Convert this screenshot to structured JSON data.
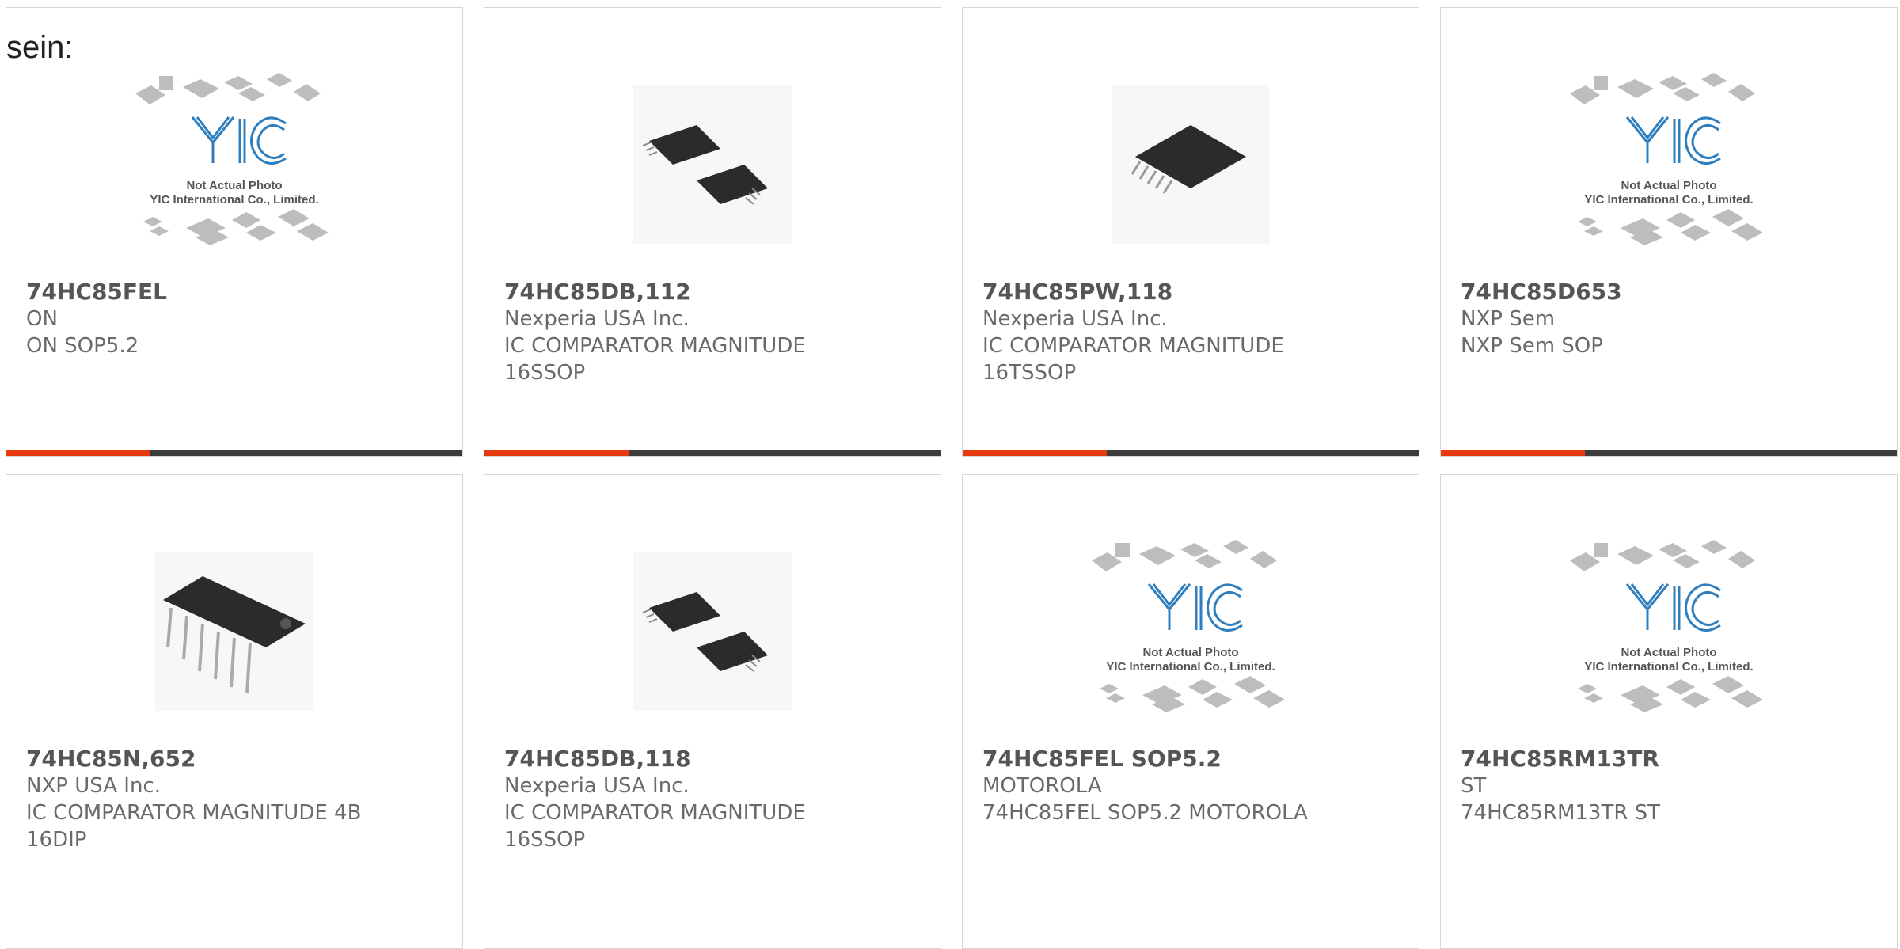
{
  "intro_text": "sein:",
  "placeholder": {
    "line1": "Not Actual Photo",
    "line2": "YIC International Co., Limited."
  },
  "colors": {
    "accent": "#e8380d",
    "bar": "#3c3c3c",
    "border": "#d6d6d6"
  },
  "products": [
    {
      "part": "74HC85FEL",
      "maker": "ON",
      "desc1": "ON SOP5.2",
      "desc2": "",
      "image": "placeholder",
      "bar": true
    },
    {
      "part": "74HC85DB,112",
      "maker": "Nexperia USA Inc.",
      "desc1": "IC COMPARATOR MAGNITUDE",
      "desc2": "16SSOP",
      "image": "ssop-pair",
      "bar": true
    },
    {
      "part": "74HC85PW,118",
      "maker": "Nexperia USA Inc.",
      "desc1": "IC COMPARATOR MAGNITUDE",
      "desc2": "16TSSOP",
      "image": "tssop",
      "bar": true
    },
    {
      "part": "74HC85D653",
      "maker": "NXP Sem",
      "desc1": "NXP Sem SOP",
      "desc2": "",
      "image": "placeholder",
      "bar": true
    },
    {
      "part": "74HC85N,652",
      "maker": "NXP USA Inc.",
      "desc1": "IC COMPARATOR MAGNITUDE 4B",
      "desc2": "16DIP",
      "image": "dip",
      "bar": false
    },
    {
      "part": "74HC85DB,118",
      "maker": "Nexperia USA Inc.",
      "desc1": "IC COMPARATOR MAGNITUDE",
      "desc2": "16SSOP",
      "image": "ssop-pair",
      "bar": false
    },
    {
      "part": "74HC85FEL SOP5.2",
      "maker": "MOTOROLA",
      "desc1": "74HC85FEL SOP5.2 MOTOROLA",
      "desc2": "",
      "image": "placeholder",
      "bar": false
    },
    {
      "part": "74HC85RM13TR",
      "maker": "ST",
      "desc1": "74HC85RM13TR ST",
      "desc2": "",
      "image": "placeholder",
      "bar": false
    }
  ]
}
